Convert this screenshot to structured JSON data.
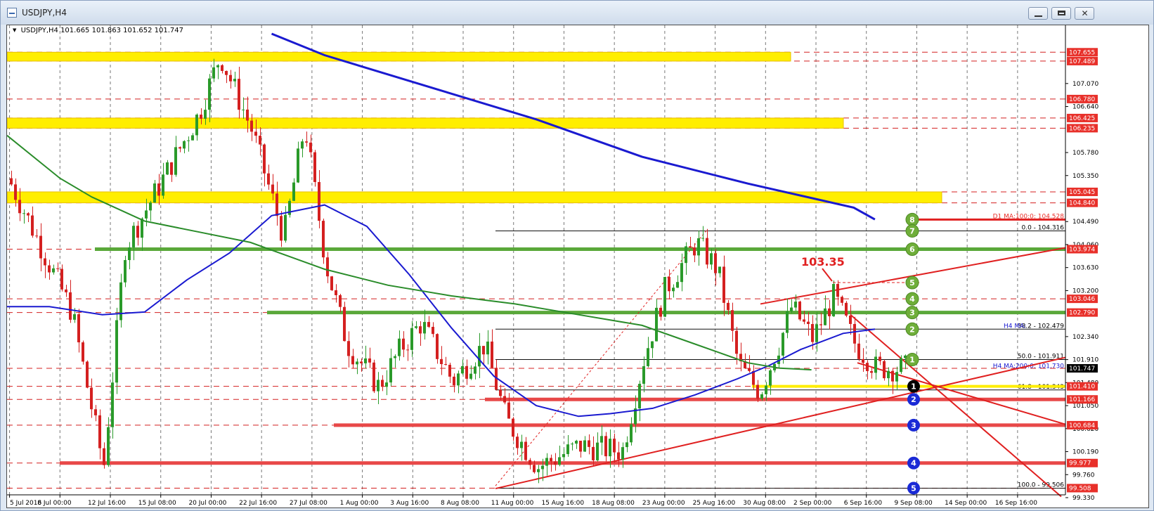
{
  "window": {
    "title": "USDJPY,H4"
  },
  "chart_header": {
    "symbol": "USDJPY,H4",
    "ohlc": "101.665 101.863 101.652 101.747"
  },
  "callout": {
    "text": "103.35"
  },
  "chart_data": {
    "type": "candlestick",
    "symbol": "USDJPY",
    "timeframe": "H4",
    "ylim": [
      99.33,
      107.93
    ],
    "price_axis_ticks": [
      107.07,
      106.64,
      105.78,
      105.35,
      104.49,
      104.06,
      103.63,
      103.2,
      102.34,
      101.91,
      101.48,
      101.05,
      100.62,
      100.19,
      99.76,
      99.33
    ],
    "time_labels": [
      "5 Jul 2016",
      "8 Jul 00:00",
      "12 Jul 16:00",
      "15 Jul 08:00",
      "20 Jul 00:00",
      "22 Jul 16:00",
      "27 Jul 08:00",
      "1 Aug 00:00",
      "3 Aug 16:00",
      "8 Aug 08:00",
      "11 Aug 00:00",
      "15 Aug 16:00",
      "18 Aug 08:00",
      "23 Aug 00:00",
      "25 Aug 16:00",
      "30 Aug 08:00",
      "2 Sep 00:00",
      "6 Sep 16:00",
      "9 Sep 08:00",
      "14 Sep 00:00",
      "16 Sep 16:00"
    ],
    "price_labels": [
      {
        "value": "107.655",
        "color": "#e8302a"
      },
      {
        "value": "107.489",
        "color": "#e8302a"
      },
      {
        "value": "106.780",
        "color": "#e8302a"
      },
      {
        "value": "106.425",
        "color": "#e8302a"
      },
      {
        "value": "106.235",
        "color": "#e8302a"
      },
      {
        "value": "105.045",
        "color": "#e8302a"
      },
      {
        "value": "104.840",
        "color": "#e8302a"
      },
      {
        "value": "103.974",
        "color": "#e8302a"
      },
      {
        "value": "103.046",
        "color": "#e8302a"
      },
      {
        "value": "102.790",
        "color": "#e8302a"
      },
      {
        "value": "101.747",
        "color": "#000000"
      },
      {
        "value": "101.410",
        "color": "#e8302a"
      },
      {
        "value": "101.166",
        "color": "#e8302a"
      },
      {
        "value": "100.684",
        "color": "#e8302a"
      },
      {
        "value": "99.977",
        "color": "#e8302a"
      },
      {
        "value": "99.508",
        "color": "#e8302a"
      }
    ],
    "resistance_zones": [
      [
        107.489,
        107.655
      ],
      [
        106.235,
        106.425
      ],
      [
        104.84,
        105.045
      ]
    ],
    "support_lines": [
      101.166,
      100.684,
      99.977
    ],
    "green_levels": [
      103.974,
      102.79
    ],
    "fibonacci": [
      {
        "label": "0.0 - 104.316",
        "value": 104.316
      },
      {
        "label": "38.2 - 102.479",
        "value": 102.479
      },
      {
        "label": "50.0 - 101.911",
        "value": 101.911
      },
      {
        "label": "61.8 - 101.343",
        "value": 101.343
      },
      {
        "label": "100.0 - 99.506",
        "value": 99.506
      }
    ],
    "moving_average_labels": [
      {
        "label": "D1 MA:100:0: 104.528",
        "value": 104.528,
        "color": "#e8302a"
      },
      {
        "label": "H4 MA:",
        "value": 102.479,
        "color": "#1a1ad0"
      },
      {
        "label": "H4 MA:200:0: 101.730",
        "value": 101.73,
        "color": "#1a1ad0"
      }
    ],
    "series": [
      {
        "name": "D1 MA:100",
        "color": "#1a1ad0",
        "points": [
          [
            0.25,
            108.0
          ],
          [
            0.3,
            107.6
          ],
          [
            0.4,
            107.0
          ],
          [
            0.5,
            106.4
          ],
          [
            0.6,
            105.7
          ],
          [
            0.7,
            105.2
          ],
          [
            0.8,
            104.75
          ],
          [
            0.82,
            104.53
          ]
        ]
      },
      {
        "name": "H4 MA:100",
        "color": "#1a1ad0",
        "points": [
          [
            0.0,
            102.9
          ],
          [
            0.04,
            102.9
          ],
          [
            0.09,
            102.75
          ],
          [
            0.13,
            102.8
          ],
          [
            0.17,
            103.4
          ],
          [
            0.21,
            103.9
          ],
          [
            0.25,
            104.6
          ],
          [
            0.3,
            104.8
          ],
          [
            0.34,
            104.4
          ],
          [
            0.38,
            103.5
          ],
          [
            0.42,
            102.5
          ],
          [
            0.46,
            101.6
          ],
          [
            0.5,
            101.05
          ],
          [
            0.54,
            100.85
          ],
          [
            0.57,
            100.9
          ],
          [
            0.61,
            101.0
          ],
          [
            0.65,
            101.25
          ],
          [
            0.69,
            101.55
          ],
          [
            0.72,
            101.8
          ],
          [
            0.75,
            102.1
          ],
          [
            0.79,
            102.4
          ],
          [
            0.82,
            102.48
          ]
        ]
      },
      {
        "name": "H4 MA:200",
        "color": "#2a8c2a",
        "points": [
          [
            0.0,
            106.1
          ],
          [
            0.05,
            105.3
          ],
          [
            0.08,
            104.95
          ],
          [
            0.13,
            104.5
          ],
          [
            0.18,
            104.3
          ],
          [
            0.23,
            104.1
          ],
          [
            0.3,
            103.6
          ],
          [
            0.36,
            103.3
          ],
          [
            0.42,
            103.1
          ],
          [
            0.48,
            102.95
          ],
          [
            0.54,
            102.75
          ],
          [
            0.6,
            102.55
          ],
          [
            0.65,
            102.2
          ],
          [
            0.7,
            101.85
          ],
          [
            0.73,
            101.75
          ],
          [
            0.76,
            101.72
          ]
        ]
      }
    ],
    "marker_levels": {
      "green": [
        {
          "label": "8",
          "value": 104.528
        },
        {
          "label": "7",
          "value": 104.316
        },
        {
          "label": "6",
          "value": 103.974
        },
        {
          "label": "5",
          "value": 103.35
        },
        {
          "label": "4",
          "value": 103.046
        },
        {
          "label": "3",
          "value": 102.79
        },
        {
          "label": "2",
          "value": 102.479
        },
        {
          "label": "1",
          "value": 101.911
        }
      ],
      "blue": [
        {
          "label": "1",
          "value": 101.41
        },
        {
          "label": "2",
          "value": 101.166
        },
        {
          "label": "3",
          "value": 100.684
        },
        {
          "label": "4",
          "value": 99.977
        },
        {
          "label": "5",
          "value": 99.508
        }
      ]
    },
    "last_price": 101.747
  }
}
